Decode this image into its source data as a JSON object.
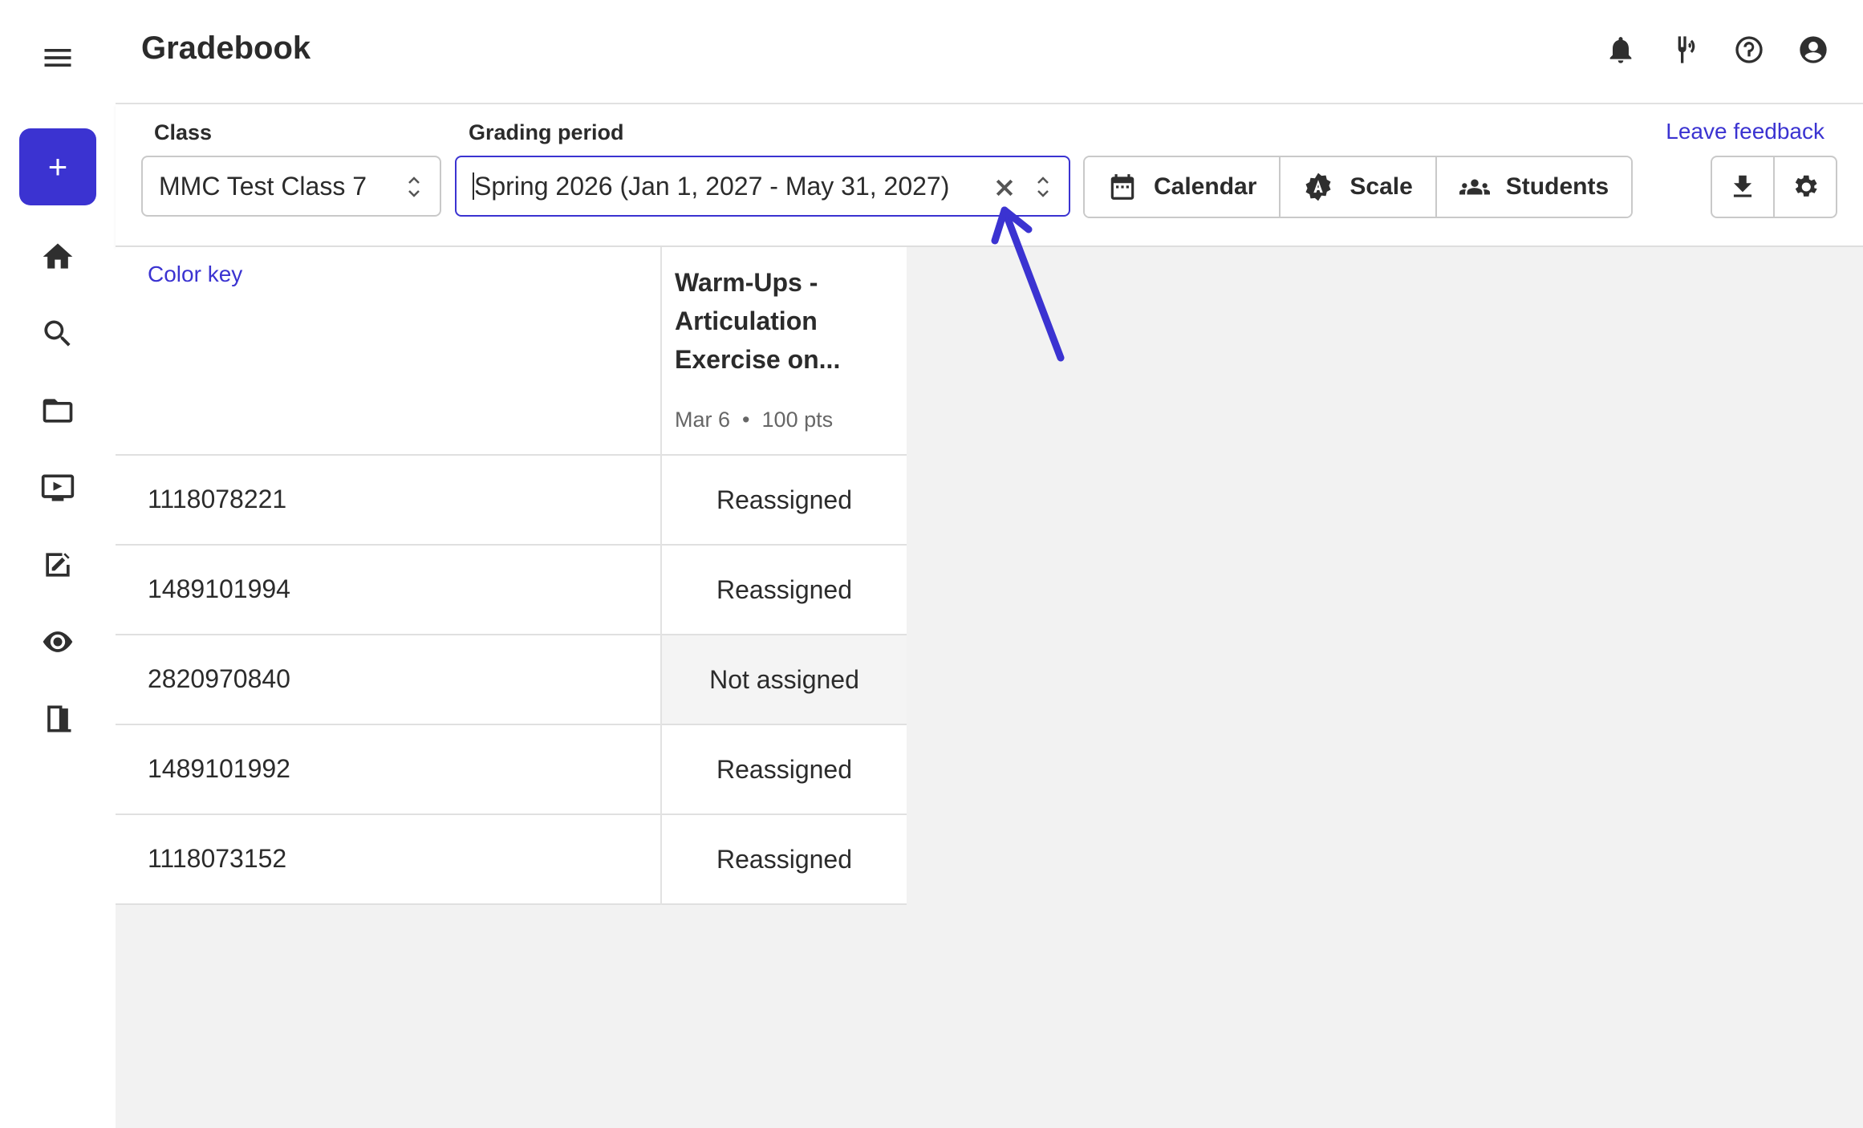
{
  "app": {
    "title": "Gradebook"
  },
  "nav": {
    "create_label": "+",
    "items": [
      "home-icon",
      "search-icon",
      "folder-icon",
      "video-icon",
      "assignment-icon",
      "ear-icon",
      "exit-icon"
    ]
  },
  "filters": {
    "class_label": "Class",
    "class_value": "MMC Test Class 7",
    "period_label": "Grading period",
    "period_value": "Spring 2026 (Jan 1, 2027 - May 31, 2027)",
    "buttons": {
      "calendar": "Calendar",
      "scale": "Scale",
      "students": "Students"
    },
    "leave_feedback": "Leave feedback"
  },
  "grid": {
    "color_key": "Color key",
    "assignment": {
      "title": "Warm-Ups - Articulation Exercise on...",
      "date": "Mar 6",
      "points": "100 pts"
    },
    "rows": [
      {
        "id": "1118078221",
        "status": "Reassigned"
      },
      {
        "id": "1489101994",
        "status": "Reassigned"
      },
      {
        "id": "2820970840",
        "status": "Not assigned"
      },
      {
        "id": "1489101992",
        "status": "Reassigned"
      },
      {
        "id": "1118073152",
        "status": "Reassigned"
      }
    ]
  },
  "colors": {
    "accent": "#3b33d1",
    "grid_bg": "#f2f2f2"
  }
}
